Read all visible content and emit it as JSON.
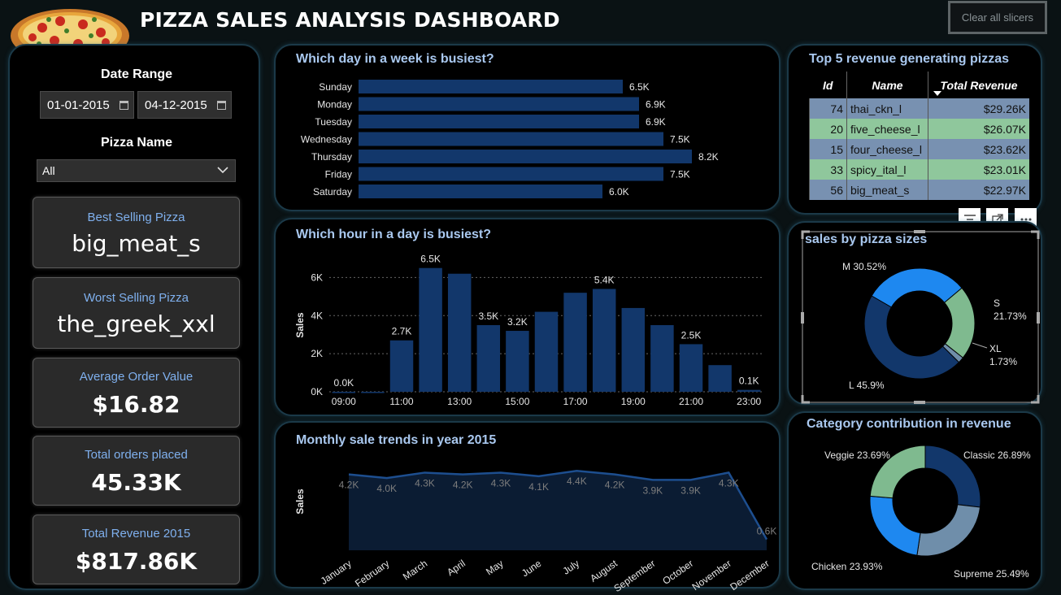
{
  "header": {
    "title": "PIZZA SALES ANALYSIS DASHBOARD",
    "clear_label": "Clear all slicers"
  },
  "slicers": {
    "date_range_label": "Date Range",
    "date_start": "01-01-2015",
    "date_end": "04-12-2015",
    "pizza_name_label": "Pizza Name",
    "pizza_name_value": "All"
  },
  "kpis": [
    {
      "label": "Best Selling Pizza",
      "value": "big_meat_s"
    },
    {
      "label": "Worst Selling Pizza",
      "value": "the_greek_xxl"
    },
    {
      "label": "Average Order Value",
      "value": "$16.82"
    },
    {
      "label": "Total orders placed",
      "value": "45.33K"
    },
    {
      "label": "Total Revenue 2015",
      "value": "$817.86K"
    }
  ],
  "top5": {
    "title": "Top 5 revenue generating pizzas",
    "columns": [
      "Id",
      "Name",
      "Total Revenue"
    ],
    "rows": [
      {
        "id": "74",
        "name": "thai_ckn_l",
        "revenue": "$29.26K"
      },
      {
        "id": "20",
        "name": "five_cheese_l",
        "revenue": "$26.07K"
      },
      {
        "id": "15",
        "name": "four_cheese_l",
        "revenue": "$23.62K"
      },
      {
        "id": "33",
        "name": "spicy_ital_l",
        "revenue": "$23.01K"
      },
      {
        "id": "56",
        "name": "big_meat_s",
        "revenue": "$22.97K"
      }
    ]
  },
  "colors": {
    "bar": "#12376b",
    "donut_m": "#1e88f0",
    "donut_s": "#7fba8f",
    "donut_xl": "#6f8eaa",
    "donut_l": "#12376b",
    "panel_border": "#1b3948",
    "title": "#a9c8ef"
  },
  "chart_data": [
    {
      "type": "bar",
      "orientation": "horizontal",
      "title": "Which day in a week is busiest?",
      "categories": [
        "Sunday",
        "Monday",
        "Tuesday",
        "Wednesday",
        "Thursday",
        "Friday",
        "Saturday"
      ],
      "values": [
        6.5,
        6.9,
        6.9,
        7.5,
        8.2,
        7.5,
        6.0
      ],
      "labels": [
        "6.5K",
        "6.9K",
        "6.9K",
        "7.5K",
        "8.2K",
        "7.5K",
        "6.0K"
      ],
      "unit": "K"
    },
    {
      "type": "bar",
      "title": "Which hour in a day is busiest?",
      "ylabel": "Sales",
      "categories": [
        "09",
        "10",
        "11",
        "12",
        "13",
        "14",
        "15",
        "16",
        "17",
        "18",
        "19",
        "20",
        "21",
        "22",
        "23"
      ],
      "tick_labels": [
        "09:00",
        "11:00",
        "13:00",
        "15:00",
        "17:00",
        "19:00",
        "21:00",
        "23:00"
      ],
      "values": [
        0.0,
        0.0,
        2.7,
        6.5,
        6.2,
        3.5,
        3.2,
        4.2,
        5.2,
        5.4,
        4.4,
        3.5,
        2.5,
        1.4,
        0.1
      ],
      "data_labels": [
        "0.0K",
        "",
        "2.7K",
        "6.5K",
        "",
        "3.5K",
        "3.2K",
        "",
        "",
        "5.4K",
        "",
        "",
        "2.5K",
        "",
        "0.1K"
      ],
      "ylim": [
        0,
        7
      ],
      "yticks": [
        "0K",
        "2K",
        "4K",
        "6K"
      ],
      "grid": true
    },
    {
      "type": "area",
      "title": "Monthly sale trends in year 2015",
      "ylabel": "Sales",
      "categories": [
        "January",
        "February",
        "March",
        "April",
        "May",
        "June",
        "July",
        "August",
        "September",
        "October",
        "November",
        "December"
      ],
      "values": [
        4.2,
        4.0,
        4.3,
        4.2,
        4.3,
        4.1,
        4.4,
        4.2,
        3.9,
        3.9,
        4.3,
        0.6
      ],
      "data_labels": [
        "4.2K",
        "4.0K",
        "4.3K",
        "4.2K",
        "4.3K",
        "4.1K",
        "4.4K",
        "4.2K",
        "3.9K",
        "3.9K",
        "4.3K",
        "0.6K"
      ]
    },
    {
      "type": "pie",
      "donut": true,
      "title": "sales by pizza sizes",
      "categories": [
        "M",
        "S",
        "XL",
        "L"
      ],
      "values": [
        30.52,
        21.73,
        1.73,
        45.9
      ],
      "labels": [
        "M 30.52%",
        "S",
        "21.73%",
        "XL",
        "1.73%",
        "L 45.9%"
      ]
    },
    {
      "type": "pie",
      "donut": true,
      "title": "Category contribution in revenue",
      "categories": [
        "Classic",
        "Supreme",
        "Chicken",
        "Veggie"
      ],
      "values": [
        26.89,
        25.49,
        23.93,
        23.69
      ],
      "labels": [
        "Classic 26.89%",
        "Supreme 25.49%",
        "Chicken 23.93%",
        "Veggie 23.69%"
      ]
    }
  ]
}
